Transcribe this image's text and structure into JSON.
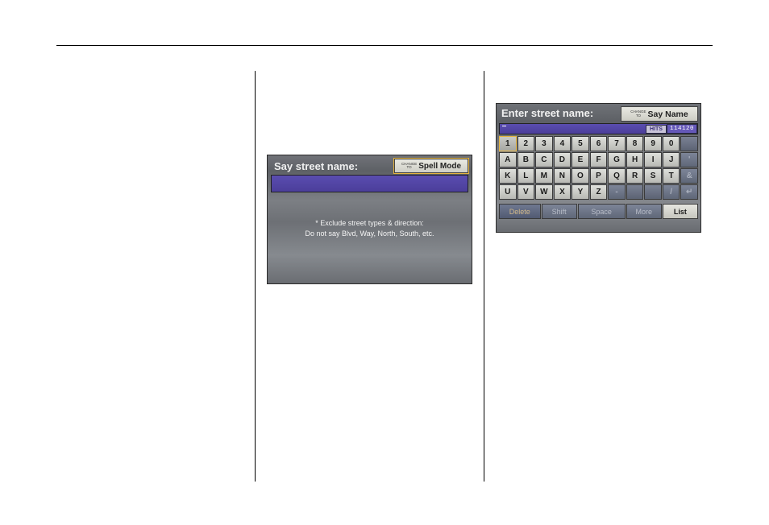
{
  "shot1": {
    "title": "Say street name:",
    "change_top": "CHANGE",
    "change_bot": "TO",
    "change_label": "Spell Mode",
    "note_line1": "* Exclude street types & direction:",
    "note_line2": "Do not say Blvd, Way, North, South, etc."
  },
  "shot2": {
    "title": "Enter street name:",
    "change_top": "CHANGE",
    "change_bot": "TO",
    "change_label": "Say Name",
    "hits_label": "HITS",
    "hits_value": "114120",
    "rows": {
      "r1": [
        "1",
        "2",
        "3",
        "4",
        "5",
        "6",
        "7",
        "8",
        "9",
        "0",
        ""
      ],
      "r2": [
        "A",
        "B",
        "C",
        "D",
        "E",
        "F",
        "G",
        "H",
        "I",
        "J",
        "'"
      ],
      "r3": [
        "K",
        "L",
        "M",
        "N",
        "O",
        "P",
        "Q",
        "R",
        "S",
        "T",
        "&"
      ],
      "r4": [
        "U",
        "V",
        "W",
        "X",
        "Y",
        "Z",
        "-",
        "",
        "",
        "/",
        "↵"
      ]
    },
    "bottom": {
      "delete": "Delete",
      "shift": "Shift",
      "space": "Space",
      "more": "More",
      "list": "List"
    }
  }
}
